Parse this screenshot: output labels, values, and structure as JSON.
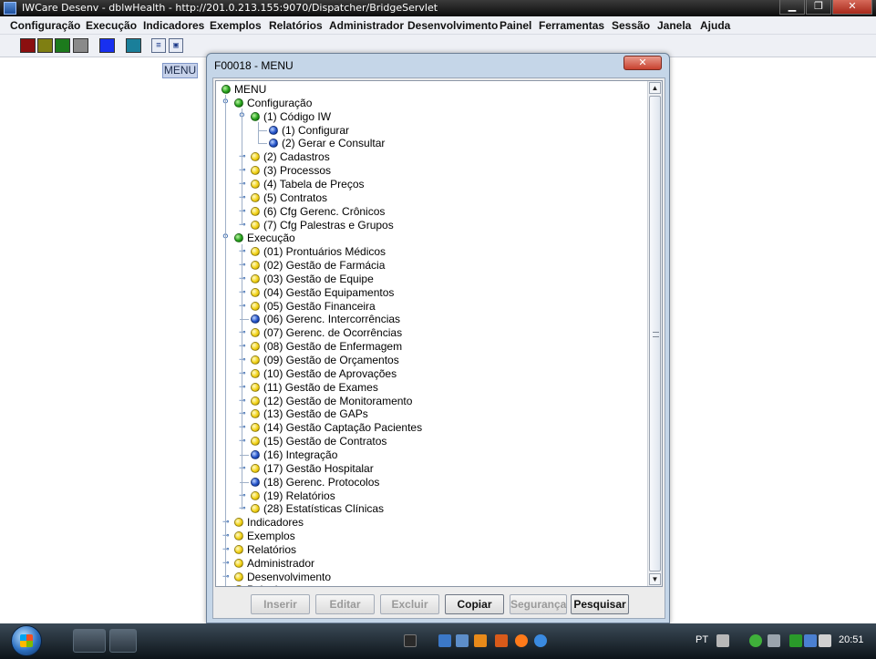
{
  "window": {
    "title": "IWCare Desenv - dblwHealth - http://201.0.213.155:9070/Dispatcher/BridgeServlet",
    "minimize": "▁",
    "maximize": "❐",
    "close": "✕"
  },
  "menubar": [
    "Configuração",
    "Execução",
    "Indicadores",
    "Exemplos",
    "Relatórios",
    "Administrador",
    "Desenvolvimento",
    "Painel",
    "Ferramentas",
    "Sessão",
    "Janela",
    "Ajuda"
  ],
  "toolbar": {
    "colors": [
      "#8b0f0f",
      "#7f7f12",
      "#1c7a1c",
      "#8a8a8a",
      "#1830f0",
      "#1a7f9a"
    ]
  },
  "desktop": {
    "menu_label": "MENU"
  },
  "dialog": {
    "title": "F00018 - MENU",
    "close": "✕",
    "tree": [
      {
        "label": "MENU",
        "color": "green"
      },
      {
        "label": "Configuração",
        "color": "green"
      },
      {
        "label": "(1) Código IW",
        "color": "green"
      },
      {
        "label": "(1) Configurar",
        "color": "blue"
      },
      {
        "label": "(2) Gerar e Consultar",
        "color": "blue"
      },
      {
        "label": "(2) Cadastros",
        "color": "yellow"
      },
      {
        "label": "(3) Processos",
        "color": "yellow"
      },
      {
        "label": "(4) Tabela de Preços",
        "color": "yellow"
      },
      {
        "label": "(5) Contratos",
        "color": "yellow"
      },
      {
        "label": "(6) Cfg Gerenc. Crônicos",
        "color": "yellow"
      },
      {
        "label": "(7) Cfg Palestras e Grupos",
        "color": "yellow"
      },
      {
        "label": "Execução",
        "color": "green"
      },
      {
        "label": "(01) Prontuários Médicos",
        "color": "yellow"
      },
      {
        "label": "(02) Gestão de Farmácia",
        "color": "yellow"
      },
      {
        "label": "(03) Gestão de Equipe",
        "color": "yellow"
      },
      {
        "label": "(04) Gestão Equipamentos",
        "color": "yellow"
      },
      {
        "label": "(05) Gestão Financeira",
        "color": "yellow"
      },
      {
        "label": "(06) Gerenc. Intercorrências",
        "color": "blue"
      },
      {
        "label": "(07) Gerenc. de Ocorrências",
        "color": "yellow"
      },
      {
        "label": "(08) Gestão de Enfermagem",
        "color": "yellow"
      },
      {
        "label": "(09) Gestão de Orçamentos",
        "color": "yellow"
      },
      {
        "label": "(10) Gestão de Aprovações",
        "color": "yellow"
      },
      {
        "label": "(11) Gestão de Exames",
        "color": "yellow"
      },
      {
        "label": "(12) Gestão de Monitoramento",
        "color": "yellow"
      },
      {
        "label": "(13) Gestão de GAPs",
        "color": "yellow"
      },
      {
        "label": "(14) Gestão Captação Pacientes",
        "color": "yellow"
      },
      {
        "label": "(15) Gestão de Contratos",
        "color": "yellow"
      },
      {
        "label": "(16) Integração",
        "color": "blue"
      },
      {
        "label": "(17) Gestão Hospitalar",
        "color": "yellow"
      },
      {
        "label": "(18) Gerenc. Protocolos",
        "color": "blue"
      },
      {
        "label": "(19) Relatórios",
        "color": "yellow"
      },
      {
        "label": "(28) Estatísticas Clínicas",
        "color": "yellow"
      },
      {
        "label": "Indicadores",
        "color": "yellow"
      },
      {
        "label": "Exemplos",
        "color": "yellow"
      },
      {
        "label": "Relatórios",
        "color": "yellow"
      },
      {
        "label": "Administrador",
        "color": "yellow"
      },
      {
        "label": "Desenvolvimento",
        "color": "yellow"
      },
      {
        "label": "Painel",
        "color": "yellow"
      }
    ],
    "buttons": [
      {
        "label": "Inserir",
        "enabled": false
      },
      {
        "label": "Editar",
        "enabled": false
      },
      {
        "label": "Excluir",
        "enabled": false
      },
      {
        "label": "Copiar",
        "enabled": true
      },
      {
        "label": "Segurança",
        "enabled": false
      },
      {
        "label": "Pesquisar",
        "enabled": true
      }
    ]
  },
  "taskbar": {
    "language": "PT",
    "clock": "20:51"
  }
}
